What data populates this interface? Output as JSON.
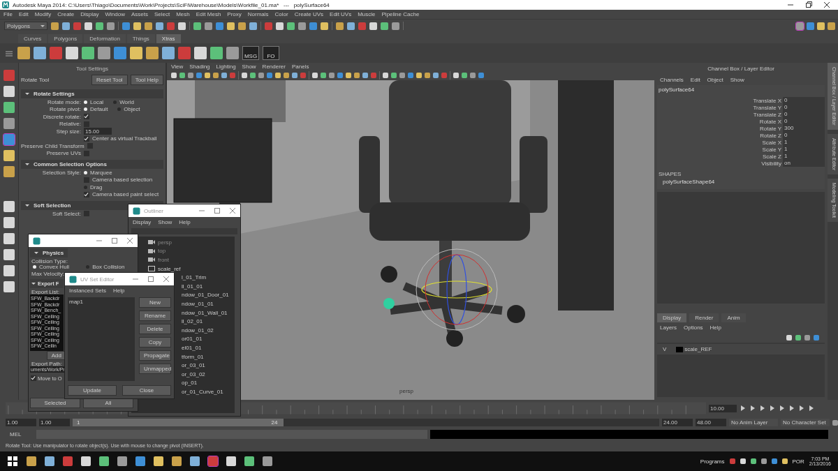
{
  "window": {
    "title": "Autodesk Maya 2014: C:\\Users\\Thiago\\Documents\\Work\\Projects\\SciFiWarehouse\\Models\\Workfile_01.ma*   ---   polySurface64"
  },
  "menu_bar": [
    "File",
    "Edit",
    "Modify",
    "Create",
    "Display",
    "Window",
    "Assets",
    "Select",
    "Mesh",
    "Edit Mesh",
    "Proxy",
    "Normals",
    "Color",
    "Create UVs",
    "Edit UVs",
    "Muscle",
    "Pipeline Cache"
  ],
  "status_line": {
    "menu_set": "Polygons"
  },
  "shelf": {
    "tabs": [
      {
        "label": "Curves",
        "selected": false
      },
      {
        "label": "Polygons",
        "selected": false
      },
      {
        "label": "Deformation",
        "selected": false
      },
      {
        "label": "Things",
        "selected": false
      },
      {
        "label": "Xtras",
        "selected": true
      }
    ],
    "labeled_icons": [
      "MSG",
      "FO"
    ]
  },
  "tool_settings": {
    "title": "Tool Settings",
    "tool": "Rotate Tool",
    "buttons": [
      "Reset Tool",
      "Tool Help"
    ],
    "sections": [
      {
        "title": "Rotate Settings",
        "rows": [
          {
            "kind": "radio",
            "label": "Rotate mode:",
            "options": [
              {
                "label": "Local",
                "selected": true
              },
              {
                "label": "World",
                "selected": false
              }
            ]
          },
          {
            "kind": "radio",
            "label": "Rotate pivot:",
            "options": [
              {
                "label": "Default",
                "selected": true
              },
              {
                "label": "Object",
                "selected": false
              }
            ]
          },
          {
            "kind": "check",
            "label": "Discrete rotate:",
            "checked": true
          },
          {
            "kind": "check",
            "label": "Relative:",
            "checked": false
          },
          {
            "kind": "field",
            "label": "Step size:",
            "value": "15.00"
          },
          {
            "kind": "option",
            "label": "Center as virtual Trackball",
            "checked": true
          },
          {
            "kind": "check",
            "label": "Preserve Child Transform",
            "checked": false
          },
          {
            "kind": "check",
            "label": "Preserve UVs",
            "checked": false
          }
        ]
      },
      {
        "title": "Common Selection Options",
        "rows": [
          {
            "kind": "radio",
            "label": "Selection Style:",
            "options": [
              {
                "label": "Marquee",
                "selected": true
              }
            ]
          },
          {
            "kind": "option",
            "label": "Camera based selection",
            "checked": false
          },
          {
            "kind": "radio",
            "options": [
              {
                "label": "Drag",
                "selected": false
              }
            ]
          },
          {
            "kind": "option",
            "label": "Camera based paint select",
            "checked": true
          }
        ]
      },
      {
        "title": "Soft Selection",
        "rows": [
          {
            "kind": "check",
            "label": "Soft Select:",
            "checked": false
          }
        ]
      }
    ]
  },
  "viewport": {
    "menu": [
      "View",
      "Shading",
      "Lighting",
      "Show",
      "Renderer",
      "Panels"
    ],
    "camera": "persp"
  },
  "outliner": {
    "title": "Outliner",
    "menu": [
      "Display",
      "Show",
      "Help"
    ],
    "items": [
      {
        "kind": "camera",
        "label": "persp"
      },
      {
        "kind": "camera",
        "label": "top"
      },
      {
        "kind": "camera",
        "label": "front"
      },
      {
        "kind": "group",
        "label": "scale_ref"
      },
      {
        "kind": "partial",
        "label": "l_01_Trim"
      },
      {
        "kind": "partial",
        "label": "ll_01_01"
      },
      {
        "kind": "partial",
        "label": "ndow_01_Door_01"
      },
      {
        "kind": "partial",
        "label": "ndow_01_01"
      },
      {
        "kind": "partial",
        "label": "ndow_01_Wall_01"
      },
      {
        "kind": "partial",
        "label": "ll_02_01"
      },
      {
        "kind": "partial",
        "label": "ndow_01_02"
      },
      {
        "kind": "partial",
        "label": "or01_01"
      },
      {
        "kind": "partial",
        "label": "el01_01"
      },
      {
        "kind": "partial",
        "label": "tform_01"
      },
      {
        "kind": "partial",
        "label": "or_03_01"
      },
      {
        "kind": "partial",
        "label": "or_03_02"
      },
      {
        "kind": "partial",
        "label": "op_01"
      },
      {
        "kind": "partial",
        "label": "or_01_Curve_01"
      }
    ]
  },
  "exporter": {
    "physics": "Physics",
    "collision_type": "Collision Type:",
    "collision_options": [
      {
        "label": "Convex Hull",
        "selected": true
      },
      {
        "label": "Box Collision",
        "selected": false
      }
    ],
    "max_velocity": "Max Velocity:",
    "export_section": "Export F",
    "export_list_label": "Export List:",
    "export_list": [
      "SFW_Backdr",
      "SFW_Backdr",
      "SFW_Bench_",
      "SFW_Ceiling",
      "SFW_Ceiling",
      "SFW_Ceiling",
      "SFW_Ceiling",
      "SFW_Ceiling",
      "SFW_Ceilin"
    ],
    "add": "Add",
    "export_path_label": "Export Path:",
    "export_path": "uments/Work/Pr",
    "move_to_origin": {
      "label": "Move to O",
      "checked": true
    },
    "buttons": [
      "Selected",
      "All"
    ]
  },
  "uv_set_editor": {
    "title": "UV Set Editor",
    "menu": [
      "Instanced Sets",
      "Help"
    ],
    "sets": [
      "map1"
    ],
    "buttons": [
      "New",
      "Rename",
      "Delete",
      "Copy",
      "Propagate",
      "Unmapped"
    ],
    "bottom_buttons": [
      "Update",
      "Close"
    ]
  },
  "channel_box": {
    "title": "Channel Box / Layer Editor",
    "menu": [
      "Channels",
      "Edit",
      "Object",
      "Show"
    ],
    "object": "polySurface64",
    "attributes": [
      {
        "label": "Translate X",
        "value": "0"
      },
      {
        "label": "Translate Y",
        "value": "0"
      },
      {
        "label": "Translate Z",
        "value": "0"
      },
      {
        "label": "Rotate X",
        "value": "0"
      },
      {
        "label": "Rotate Y",
        "value": "300"
      },
      {
        "label": "Rotate Z",
        "value": "0"
      },
      {
        "label": "Scale X",
        "value": "1"
      },
      {
        "label": "Scale Y",
        "value": "1"
      },
      {
        "label": "Scale Z",
        "value": "1"
      },
      {
        "label": "Visibility",
        "value": "on"
      }
    ],
    "shapes_heading": "SHAPES",
    "shape": "polySurfaceShape64"
  },
  "layer_editor": {
    "tabs": [
      {
        "label": "Display",
        "selected": true
      },
      {
        "label": "Render",
        "selected": false
      },
      {
        "label": "Anim",
        "selected": false
      }
    ],
    "menu": [
      "Layers",
      "Options",
      "Help"
    ],
    "layers": [
      {
        "visibility": "V",
        "name": "scale_REF",
        "color": "#000000"
      }
    ]
  },
  "side_tabs": [
    {
      "label": "Channel Box / Layer Editor",
      "selected": true
    },
    {
      "label": "Attribute Editor",
      "selected": false
    },
    {
      "label": "Modeling Toolkit",
      "selected": false
    }
  ],
  "time_slider": {
    "current_time": "10.00"
  },
  "range_slider": {
    "start": "1.00",
    "range_start": "1.00",
    "level": 0.36,
    "handle_start": "1",
    "handle_end": "24",
    "range_end": "24.00",
    "end": "48.00",
    "anim_layer": "No Anim Layer",
    "character_set": "No Character Set"
  },
  "command_line": {
    "language": "MEL"
  },
  "help_line": "Rotate Tool: Use manipulator to rotate object(s). Use with mouse to change pivot (INSERT).",
  "taskbar": {
    "programs": "Programs",
    "language": "POR",
    "time": "7:03 PM",
    "date": "2/13/2016"
  }
}
